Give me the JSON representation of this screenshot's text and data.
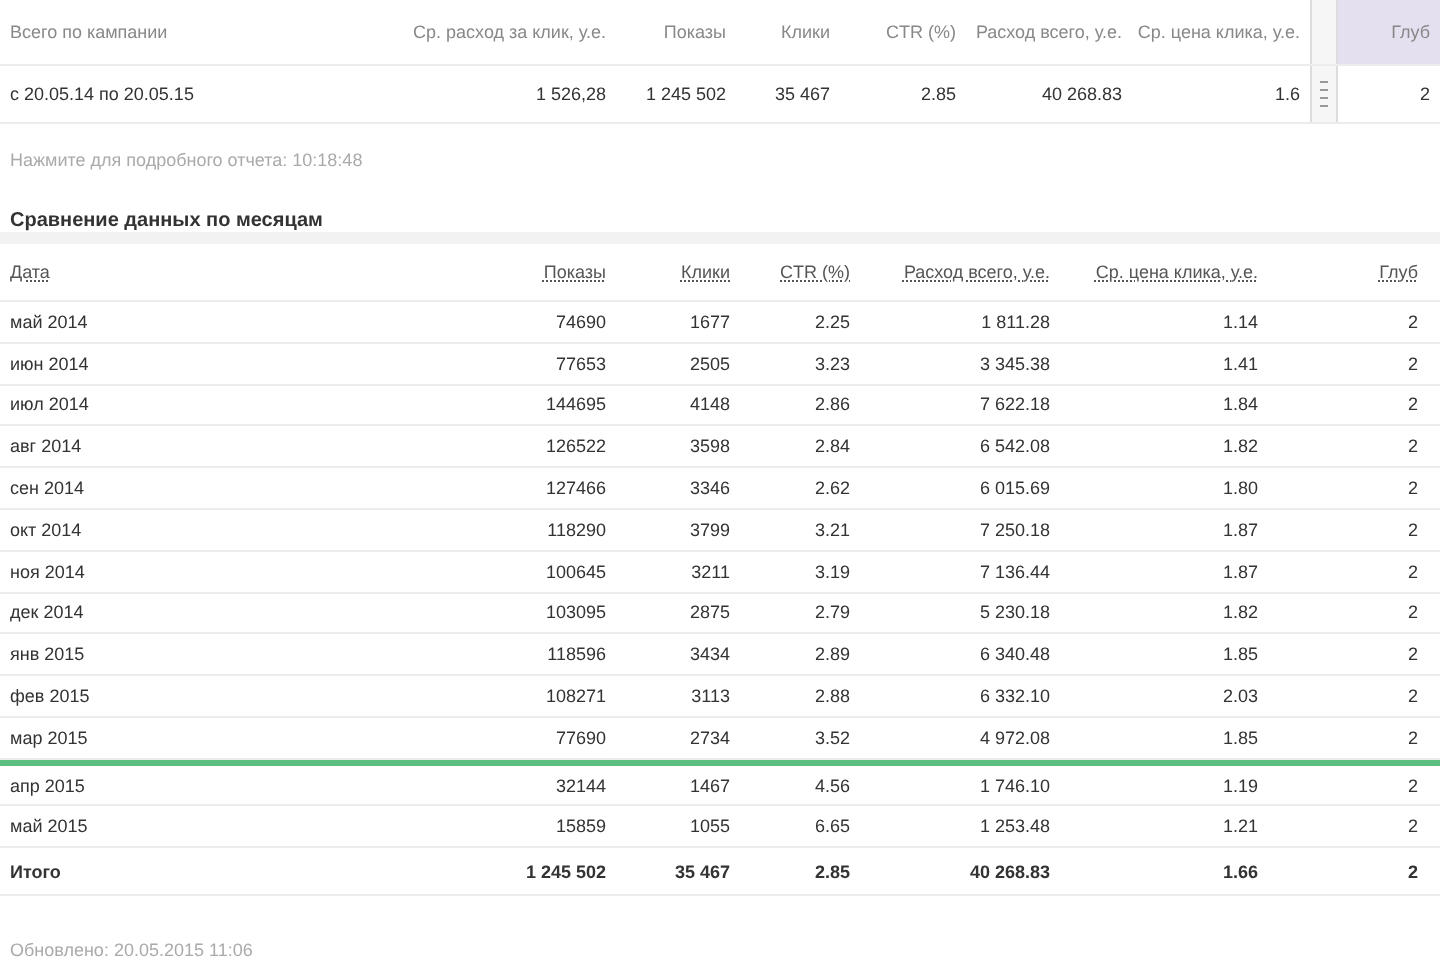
{
  "summary": {
    "columns": [
      "Всего по кампании",
      "Ср. расход за клик, у.е.",
      "Показы",
      "Клики",
      "CTR (%)",
      "Расход всего, у.е.",
      "Ср. цена клика, у.е.",
      "Глуб"
    ],
    "sorted": [
      false,
      false,
      false,
      false,
      false,
      false,
      false,
      true
    ],
    "row": [
      "с 20.05.14 по 20.05.15",
      "1 526,28",
      "1 245 502",
      "35 467",
      "2.85",
      "40 268.83",
      "1.6",
      "2"
    ]
  },
  "note": "Нажмите для подробного отчета: 10:18:48",
  "monthly": {
    "title": "Сравнение данных по месяцам",
    "columns": [
      "Дата",
      "Показы",
      "Клики",
      "CTR (%)",
      "Расход всего, у.е.",
      "Ср. цена клика, у.е.",
      "Глуб"
    ],
    "rows": [
      {
        "cells": [
          "май 2014",
          "74690",
          "1677",
          "2.25",
          "1 811.28",
          "1.14",
          "2"
        ],
        "marker_below": false
      },
      {
        "cells": [
          "июн 2014",
          "77653",
          "2505",
          "3.23",
          "3 345.38",
          "1.41",
          "2"
        ],
        "marker_below": false
      },
      {
        "cells": [
          "июл 2014",
          "144695",
          "4148",
          "2.86",
          "7 622.18",
          "1.84",
          "2"
        ],
        "marker_below": false
      },
      {
        "cells": [
          "авг 2014",
          "126522",
          "3598",
          "2.84",
          "6 542.08",
          "1.82",
          "2"
        ],
        "marker_below": false
      },
      {
        "cells": [
          "сен 2014",
          "127466",
          "3346",
          "2.62",
          "6 015.69",
          "1.80",
          "2"
        ],
        "marker_below": false
      },
      {
        "cells": [
          "окт 2014",
          "118290",
          "3799",
          "3.21",
          "7 250.18",
          "1.87",
          "2"
        ],
        "marker_below": false
      },
      {
        "cells": [
          "ноя 2014",
          "100645",
          "3211",
          "3.19",
          "7 136.44",
          "1.87",
          "2"
        ],
        "marker_below": false
      },
      {
        "cells": [
          "дек 2014",
          "103095",
          "2875",
          "2.79",
          "5 230.18",
          "1.82",
          "2"
        ],
        "marker_below": false
      },
      {
        "cells": [
          "янв 2015",
          "118596",
          "3434",
          "2.89",
          "6 340.48",
          "1.85",
          "2"
        ],
        "marker_below": false
      },
      {
        "cells": [
          "фев 2015",
          "108271",
          "3113",
          "2.88",
          "6 332.10",
          "2.03",
          "2"
        ],
        "marker_below": false
      },
      {
        "cells": [
          "мар 2015",
          "77690",
          "2734",
          "3.52",
          "4 972.08",
          "1.85",
          "2"
        ],
        "marker_below": true
      },
      {
        "cells": [
          "апр 2015",
          "32144",
          "1467",
          "4.56",
          "1 746.10",
          "1.19",
          "2"
        ],
        "marker_below": false
      },
      {
        "cells": [
          "май 2015",
          "15859",
          "1055",
          "6.65",
          "1 253.48",
          "1.21",
          "2"
        ],
        "marker_below": false
      }
    ],
    "total": [
      "Итого",
      "1 245 502",
      "35 467",
      "2.85",
      "40 268.83",
      "1.66",
      "2"
    ]
  },
  "footer": "Обновлено: 20.05.2015 11:06"
}
